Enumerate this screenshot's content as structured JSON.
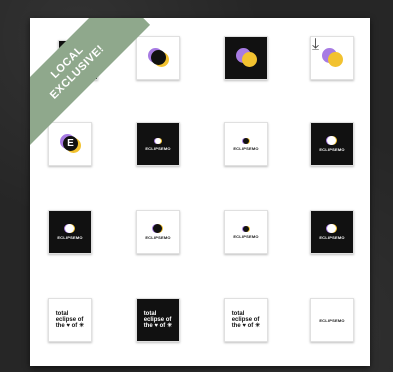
{
  "badge": {
    "line1": "LOCAL",
    "line2": "EXCLUSIVE!"
  },
  "brand": {
    "name": "ECLIPSEMO",
    "letter": "E"
  },
  "total_text": {
    "line1": "total",
    "line2": "eclipse of",
    "line3": "the ♥ of ☀"
  },
  "colors": {
    "purple": "#a77be3",
    "yellow": "#f2c230",
    "card": "#ffffff",
    "ribbon": "#8fa88c"
  },
  "icons": {
    "download": "download-icon"
  }
}
